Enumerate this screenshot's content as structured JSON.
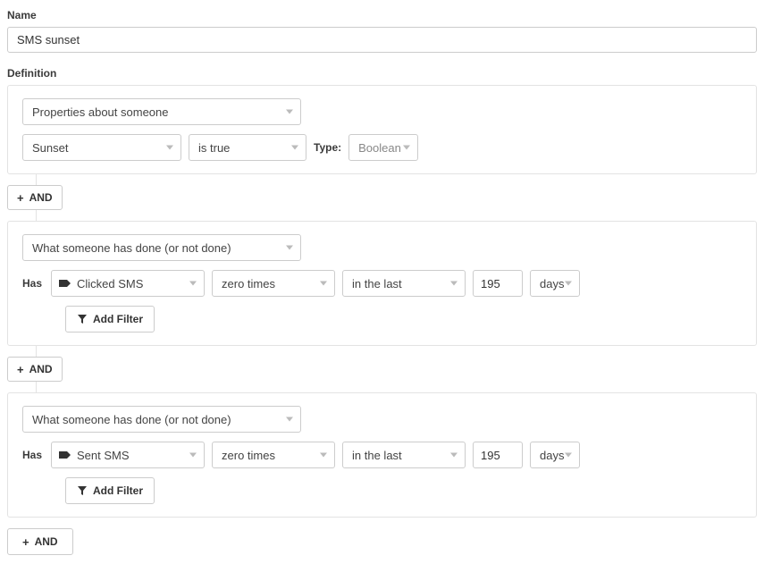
{
  "labels": {
    "name": "Name",
    "definition": "Definition",
    "type": "Type:",
    "has": "Has",
    "and_small": "AND",
    "and_big": "AND",
    "add_filter": "Add Filter"
  },
  "name_value": "SMS sunset",
  "block1": {
    "kind": "Properties about someone",
    "property": "Sunset",
    "operator": "is true",
    "type_value": "Boolean"
  },
  "block2": {
    "kind": "What someone has done (or not done)",
    "event": "Clicked SMS",
    "times": "zero times",
    "range": "in the last",
    "count": "195",
    "unit": "days"
  },
  "block3": {
    "kind": "What someone has done (or not done)",
    "event": "Sent SMS",
    "times": "zero times",
    "range": "in the last",
    "count": "195",
    "unit": "days"
  }
}
